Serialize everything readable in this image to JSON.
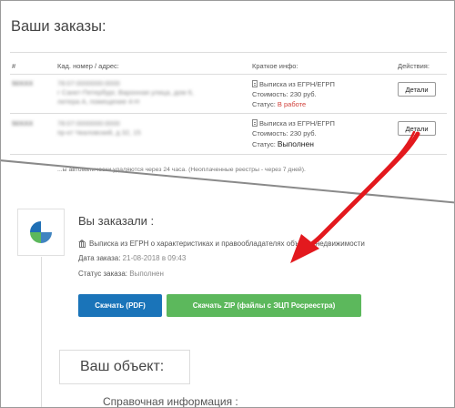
{
  "orders_page": {
    "title": "Ваши заказы:",
    "columns": [
      "#",
      "Кад. номер / адрес:",
      "Краткое инфо:",
      "Действия:"
    ],
    "rows": [
      {
        "number": "50XXX",
        "address_line1": "78:07:0000000:0000",
        "address_line2": "г Санкт-Петербург, Варонная улица, дом 6,",
        "address_line3": "литера А, помещение 4-Н",
        "info_type": "Выписка из ЕГРН/ЕГРП",
        "cost": "Стоимость: 230 руб.",
        "status_label": "Статус:",
        "status_value": "В работе",
        "action_label": "Детали"
      },
      {
        "number": "50XXX",
        "address_line1": "78:07:0000000:0000",
        "address_line2": "пр-кт Чкаловский, д 32, 15",
        "address_line3": "",
        "info_type": "Выписка из ЕГРН/ЕГРП",
        "cost": "Стоимость: 230 руб.",
        "status_label": "Статус:",
        "status_value": "Выполнен",
        "action_label": "Детали"
      }
    ],
    "note": "...ы автоматически удаляются через 24 часа. (Неоплаченные реестры - через 7 дней)."
  },
  "order_detail": {
    "heading": "Вы заказали :",
    "item": "Выписка из ЕГРН о характеристиках и правообладателях объекта недвижимости",
    "date_label": "Дата заказа:",
    "date_value": "21-08-2018 в 09:43",
    "status_label": "Статус заказа:",
    "status_value": "Выполнен",
    "download_pdf": "Скачать (PDF)",
    "download_zip": "Скачать ZIP (файлы с ЭЦП Росреестра)",
    "object_title": "Ваш объект:",
    "reference_title": "Справочная информация :"
  },
  "colors": {
    "primary_blue": "#1a74b9",
    "success_green": "#5cb85c",
    "status_red": "#d0403a",
    "arrow_red": "#e3191e",
    "logo_blue": "#1f6fb5",
    "logo_green": "#5cb85c"
  },
  "icons": [
    "document-icon",
    "bank-icon",
    "rosreestr-logo-icon",
    "red-arrow-annotation"
  ]
}
